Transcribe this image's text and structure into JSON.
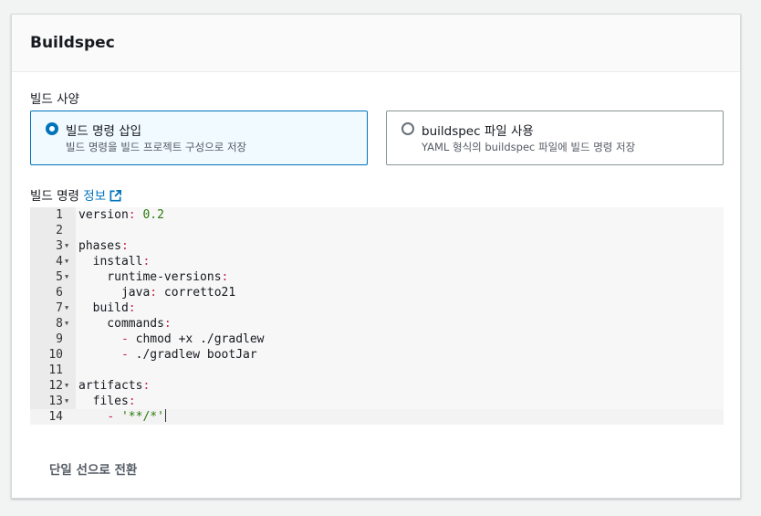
{
  "panel": {
    "title": "Buildspec"
  },
  "build_spec_section": {
    "label": "빌드 사양",
    "options": [
      {
        "title": "빌드 명령 삽입",
        "description": "빌드 명령을 빌드 프로젝트 구성으로 저장",
        "selected": true
      },
      {
        "title": "buildspec 파일 사용",
        "description": "YAML 형식의 buildspec 파일에 빌드 명령 저장",
        "selected": false
      }
    ]
  },
  "build_commands": {
    "label": "빌드 명령",
    "info_link": "정보"
  },
  "editor": {
    "lines": [
      {
        "n": "1",
        "fold": false,
        "html": "version<span class='p'>:</span> <span class='v'>0.2</span>"
      },
      {
        "n": "2",
        "fold": false,
        "html": ""
      },
      {
        "n": "3",
        "fold": true,
        "html": "phases<span class='p'>:</span>"
      },
      {
        "n": "4",
        "fold": true,
        "html": "  install<span class='p'>:</span>"
      },
      {
        "n": "5",
        "fold": true,
        "html": "    runtime-versions<span class='p'>:</span>"
      },
      {
        "n": "6",
        "fold": false,
        "html": "      java<span class='p'>:</span> corretto21"
      },
      {
        "n": "7",
        "fold": true,
        "html": "  build<span class='p'>:</span>"
      },
      {
        "n": "8",
        "fold": true,
        "html": "    commands<span class='p'>:</span>"
      },
      {
        "n": "9",
        "fold": false,
        "html": "      <span class='p'>-</span> chmod +x ./gradlew"
      },
      {
        "n": "10",
        "fold": false,
        "html": "      <span class='p'>-</span> ./gradlew bootJar"
      },
      {
        "n": "11",
        "fold": false,
        "html": ""
      },
      {
        "n": "12",
        "fold": true,
        "html": "artifacts<span class='p'>:</span>"
      },
      {
        "n": "13",
        "fold": true,
        "html": "  files<span class='p'>:</span>"
      },
      {
        "n": "14",
        "fold": false,
        "html": "    <span class='p'>-</span> <span class='v'>'**/*'</span>",
        "active": true
      }
    ]
  },
  "footer": {
    "toggle_label": "단일 선으로 전환"
  },
  "colors": {
    "accent": "#0073bb",
    "selected_bg": "#f1faff"
  }
}
